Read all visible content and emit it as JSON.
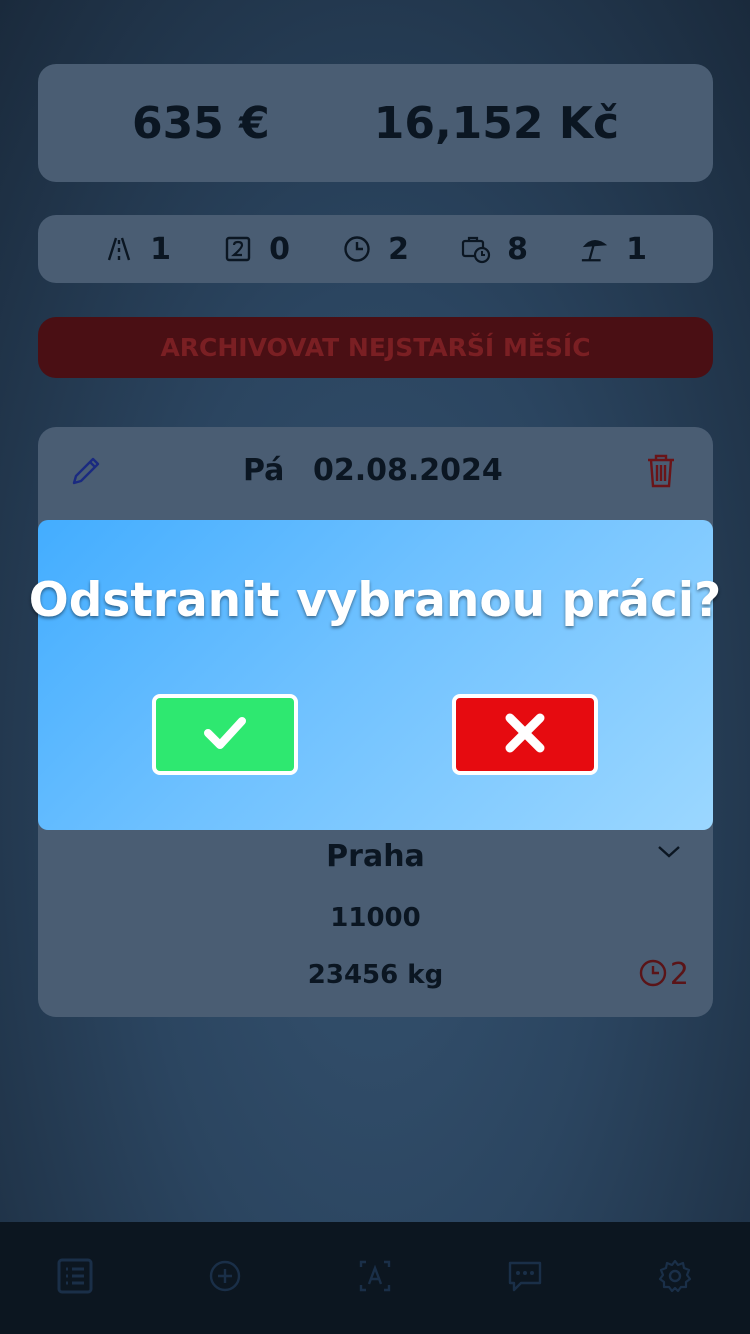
{
  "summary": {
    "euro_total": "635 €",
    "czk_total": "16,152 Kč"
  },
  "stats": [
    {
      "icon": "road-icon",
      "value": "1"
    },
    {
      "icon": "number-two-box-icon",
      "value": "0"
    },
    {
      "icon": "clock-icon",
      "value": "2"
    },
    {
      "icon": "briefcase-clock-icon",
      "value": "8"
    },
    {
      "icon": "beach-umbrella-icon",
      "value": "1"
    }
  ],
  "archive_button": {
    "label": "ARCHIVOVAT NEJSTARŠÍ MĚSÍC"
  },
  "work_item": {
    "day": "Pá",
    "date": "02.08.2024",
    "city": "Praha",
    "code": "11000",
    "weight": "23456 kg",
    "wait_count": "2"
  },
  "dialog": {
    "title": "Odstranit vybranou práci?",
    "confirm_icon": "check-icon",
    "cancel_icon": "close-icon"
  },
  "tabs": [
    {
      "icon": "list-icon"
    },
    {
      "icon": "add-circle-icon"
    },
    {
      "icon": "translate-icon"
    },
    {
      "icon": "chat-icon"
    },
    {
      "icon": "gear-icon"
    }
  ],
  "colors": {
    "confirm": "#2ee870",
    "cancel": "#e60b10",
    "dialog_gradient_start": "#43adff",
    "dialog_gradient_end": "#9bd7ff",
    "archive_dimmed": "#4a0f14"
  }
}
